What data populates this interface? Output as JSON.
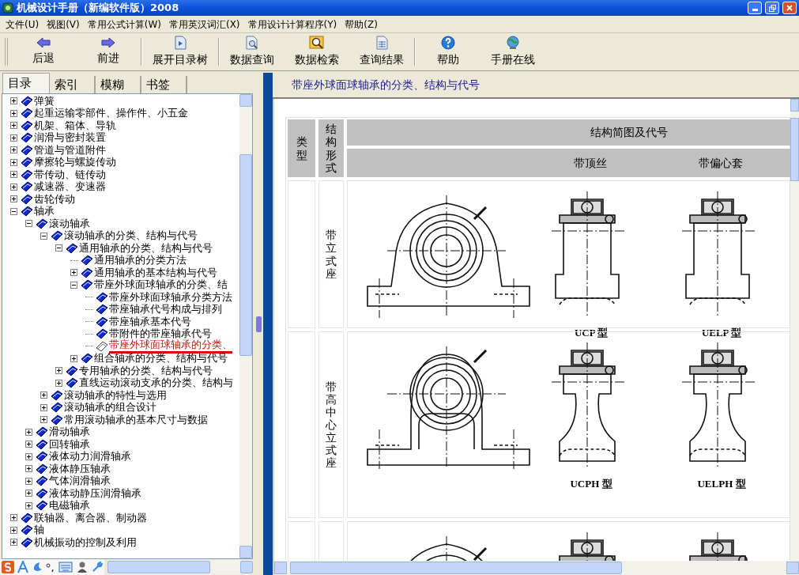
{
  "window": {
    "title": "机械设计手册（新编软件版）2008"
  },
  "menu": [
    "文件(U)",
    "视图(V)",
    "常用公式计算(W)",
    "常用英汉词汇(X)",
    "常用设计计算程序(Y)",
    "帮助(Z)"
  ],
  "toolbar": [
    {
      "label": "后退",
      "kind": "back",
      "separator_before": false
    },
    {
      "label": "前进",
      "kind": "forward",
      "separator_before": false
    },
    {
      "label": "展开目录树",
      "kind": "tree",
      "separator_before": true
    },
    {
      "label": "数据查询",
      "kind": "query",
      "separator_before": true
    },
    {
      "label": "数据检索",
      "kind": "search",
      "separator_before": false
    },
    {
      "label": "查询结果",
      "kind": "result",
      "separator_before": false
    },
    {
      "label": "帮助",
      "kind": "help",
      "separator_before": true
    },
    {
      "label": "手册在线",
      "kind": "online",
      "separator_before": false
    }
  ],
  "tabs": [
    {
      "label": "目录",
      "selected": true
    },
    {
      "label": "索引",
      "selected": false
    },
    {
      "label": "模糊",
      "selected": false
    },
    {
      "label": "书签",
      "selected": false
    }
  ],
  "tree": [
    {
      "label": "弹簧",
      "kind": "folder",
      "expanded": false,
      "selected": false
    },
    {
      "label": "起重运输零部件、操作件、小五金",
      "kind": "folder",
      "expanded": false,
      "selected": false
    },
    {
      "label": "机架、箱体、导轨",
      "kind": "folder",
      "expanded": false,
      "selected": false
    },
    {
      "label": "润滑与密封装置",
      "kind": "folder",
      "expanded": false,
      "selected": false
    },
    {
      "label": "管道与管道附件",
      "kind": "folder",
      "expanded": false,
      "selected": false
    },
    {
      "label": "摩擦轮与螺旋传动",
      "kind": "folder",
      "expanded": false,
      "selected": false
    },
    {
      "label": "带传动、链传动",
      "kind": "folder",
      "expanded": false,
      "selected": false
    },
    {
      "label": "减速器、变速器",
      "kind": "folder",
      "expanded": false,
      "selected": false
    },
    {
      "label": "齿轮传动",
      "kind": "folder",
      "expanded": false,
      "selected": false
    },
    {
      "label": "轴承",
      "kind": "folder",
      "expanded": true,
      "selected": false,
      "children": [
        {
          "label": "滚动轴承",
          "kind": "folder",
          "expanded": true,
          "selected": false,
          "children": [
            {
              "label": "滚动轴承的分类、结构与代号",
              "kind": "folder",
              "expanded": true,
              "selected": false,
              "children": [
                {
                  "label": "通用轴承的分类、结构与代号",
                  "kind": "folder",
                  "expanded": true,
                  "selected": false,
                  "children": [
                    {
                      "label": "通用轴承的分类方法",
                      "kind": "page",
                      "selected": false
                    },
                    {
                      "label": "通用轴承的基本结构与代号",
                      "kind": "folder",
                      "expanded": false,
                      "selected": false
                    },
                    {
                      "label": "带座外球面球轴承的分类、结",
                      "kind": "folder",
                      "expanded": true,
                      "selected": false,
                      "children": [
                        {
                          "label": "带座外球面球轴承分类方法",
                          "kind": "page",
                          "selected": false
                        },
                        {
                          "label": "带座轴承代号构成与排列",
                          "kind": "page",
                          "selected": false
                        },
                        {
                          "label": "带座轴承基本代号",
                          "kind": "page",
                          "selected": false
                        },
                        {
                          "label": "带附件的带座轴承代号",
                          "kind": "page",
                          "selected": false
                        },
                        {
                          "label": "带座外球面球轴承的分类、",
                          "kind": "page",
                          "selected": true
                        }
                      ]
                    },
                    {
                      "label": "组合轴承的分类、结构与代号",
                      "kind": "folder",
                      "expanded": false,
                      "selected": false
                    }
                  ]
                },
                {
                  "label": "专用轴承的分类、结构与代号",
                  "kind": "folder",
                  "expanded": false,
                  "selected": false
                },
                {
                  "label": "直线运动滚动支承的分类、结构与",
                  "kind": "folder",
                  "expanded": false,
                  "selected": false
                }
              ]
            },
            {
              "label": "滚动轴承的特性与选用",
              "kind": "folder",
              "expanded": false,
              "selected": false
            },
            {
              "label": "滚动轴承的组合设计",
              "kind": "folder",
              "expanded": false,
              "selected": false
            },
            {
              "label": "常用滚动轴承的基本尺寸与数据",
              "kind": "folder",
              "expanded": false,
              "selected": false
            }
          ]
        },
        {
          "label": "滑动轴承",
          "kind": "folder",
          "expanded": false,
          "selected": false
        },
        {
          "label": "回转轴承",
          "kind": "folder",
          "expanded": false,
          "selected": false
        },
        {
          "label": "液体动力润滑轴承",
          "kind": "folder",
          "expanded": false,
          "selected": false
        },
        {
          "label": "液体静压轴承",
          "kind": "folder",
          "expanded": false,
          "selected": false
        },
        {
          "label": "气体润滑轴承",
          "kind": "folder",
          "expanded": false,
          "selected": false
        },
        {
          "label": "液体动静压润滑轴承",
          "kind": "folder",
          "expanded": false,
          "selected": false
        },
        {
          "label": "电磁轴承",
          "kind": "folder",
          "expanded": false,
          "selected": false
        }
      ]
    },
    {
      "label": "联轴器、离合器、制动器",
      "kind": "folder",
      "expanded": false,
      "selected": false
    },
    {
      "label": "轴",
      "kind": "folder",
      "expanded": false,
      "selected": false
    },
    {
      "label": "机械振动的控制及利用",
      "kind": "folder",
      "expanded": false,
      "selected": false
    }
  ],
  "content": {
    "title": "带座外球面球轴承的分类、结构与代号",
    "table": {
      "columns": [
        "类型",
        "结构形式",
        "结构简图及代号"
      ],
      "subcolumns": [
        "带顶丝",
        "带偏心套"
      ],
      "rows": [
        {
          "form": "带立式座",
          "kind": "standard",
          "labels": [
            "UCP 型",
            "UELP 型"
          ]
        },
        {
          "form": "带高中心立式座",
          "kind": "high",
          "labels": [
            "UCPH 型",
            "UELPH 型"
          ]
        },
        {
          "kind": "partial"
        }
      ]
    }
  }
}
